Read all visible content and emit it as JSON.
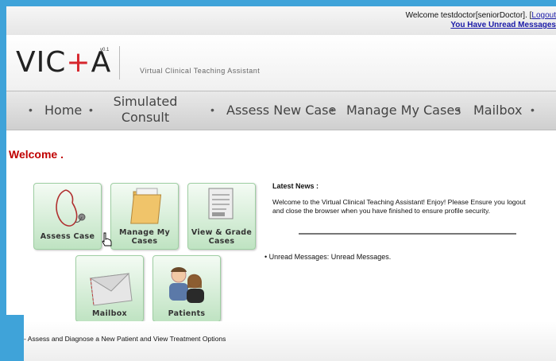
{
  "header": {
    "welcome_prefix": "Welcome testdoctor[seniorDoctor]. [",
    "logout_link": "Logout",
    "unread_link": "You Have Unread Messages"
  },
  "logo": {
    "text_left": "VIC",
    "text_plus": "+",
    "text_right": "A",
    "version": "v0.1",
    "tagline": "Virtual Clinical Teaching Assistant"
  },
  "nav": {
    "items": [
      {
        "label": "Home"
      },
      {
        "label": "Simulated\nConsult"
      },
      {
        "label": "Assess New Case"
      },
      {
        "label": "Manage My Cases"
      },
      {
        "label": "Mailbox"
      }
    ],
    "separator": "•"
  },
  "main": {
    "heading": "Welcome .",
    "tiles": [
      {
        "label": "Assess Case",
        "icon": "stethoscope-icon"
      },
      {
        "label": "Manage My Cases",
        "icon": "folder-icon"
      },
      {
        "label": "View & Grade Cases",
        "icon": "document-icon"
      },
      {
        "label": "Mailbox",
        "icon": "envelope-icon"
      },
      {
        "label": "Patients",
        "icon": "people-icon"
      }
    ],
    "hint": "- Assess and Diagnose a New Patient and View Treatment Options"
  },
  "news": {
    "title": "Latest News :",
    "body": "Welcome to the Virtual Clinical Teaching Assistant! Enjoy! Please Ensure you logout and close the browser when you have finished to ensure profile security.",
    "unread": "Unread Messages: Unread Messages."
  },
  "colors": {
    "accent_red": "#c00000",
    "link_blue": "#1a1aa8",
    "tile_green": "#bfe3c2",
    "frame_blue": "#3fa3d9"
  }
}
